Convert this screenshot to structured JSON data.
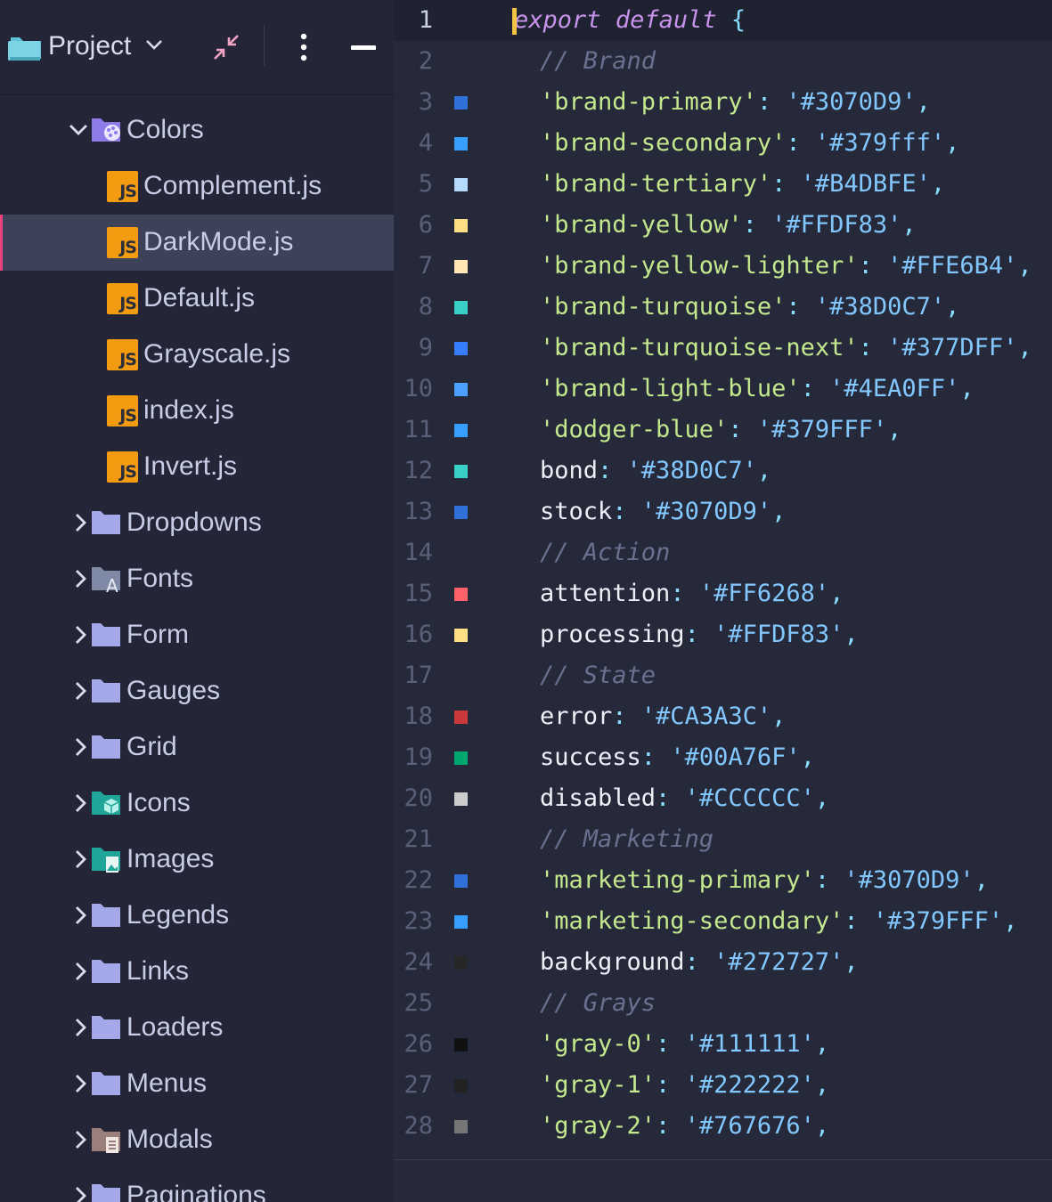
{
  "sidebar": {
    "title": "Project",
    "tree": [
      {
        "label": "Colors",
        "type": "folder-open",
        "icon": "palette-folder-icon"
      },
      {
        "label": "Complement.js",
        "type": "js"
      },
      {
        "label": "DarkMode.js",
        "type": "js",
        "selected": true
      },
      {
        "label": "Default.js",
        "type": "js"
      },
      {
        "label": "Grayscale.js",
        "type": "js"
      },
      {
        "label": "index.js",
        "type": "js"
      },
      {
        "label": "Invert.js",
        "type": "js"
      },
      {
        "label": "Dropdowns",
        "type": "folder"
      },
      {
        "label": "Fonts",
        "type": "folder-fonts"
      },
      {
        "label": "Form",
        "type": "folder"
      },
      {
        "label": "Gauges",
        "type": "folder"
      },
      {
        "label": "Grid",
        "type": "folder"
      },
      {
        "label": "Icons",
        "type": "folder-icons"
      },
      {
        "label": "Images",
        "type": "folder-images"
      },
      {
        "label": "Legends",
        "type": "folder"
      },
      {
        "label": "Links",
        "type": "folder"
      },
      {
        "label": "Loaders",
        "type": "folder"
      },
      {
        "label": "Menus",
        "type": "folder"
      },
      {
        "label": "Modals",
        "type": "folder-modals"
      },
      {
        "label": "Paginations",
        "type": "folder"
      }
    ],
    "js_badge": "JS"
  },
  "editor": {
    "lines": [
      {
        "n": "1",
        "kind": "open",
        "t1": "export",
        "t2": "default",
        "t3": "{"
      },
      {
        "n": "2",
        "kind": "comment",
        "text": "// Brand"
      },
      {
        "n": "3",
        "kind": "qkey",
        "key": "'brand-primary'",
        "val": "'#3070D9'",
        "swatch": "#3070D9"
      },
      {
        "n": "4",
        "kind": "qkey",
        "key": "'brand-secondary'",
        "val": "'#379fff'",
        "swatch": "#379fff"
      },
      {
        "n": "5",
        "kind": "qkey",
        "key": "'brand-tertiary'",
        "val": "'#B4DBFE'",
        "swatch": "#B4DBFE"
      },
      {
        "n": "6",
        "kind": "qkey",
        "key": "'brand-yellow'",
        "val": "'#FFDF83'",
        "swatch": "#FFDF83"
      },
      {
        "n": "7",
        "kind": "qkey",
        "key": "'brand-yellow-lighter'",
        "val": "'#FFE6B4'",
        "swatch": "#FFE6B4"
      },
      {
        "n": "8",
        "kind": "qkey",
        "key": "'brand-turquoise'",
        "val": "'#38D0C7'",
        "swatch": "#38D0C7"
      },
      {
        "n": "9",
        "kind": "qkey",
        "key": "'brand-turquoise-next'",
        "val": "'#377DFF'",
        "swatch": "#377DFF"
      },
      {
        "n": "10",
        "kind": "qkey",
        "key": "'brand-light-blue'",
        "val": "'#4EA0FF'",
        "swatch": "#4EA0FF"
      },
      {
        "n": "11",
        "kind": "qkey",
        "key": "'dodger-blue'",
        "val": "'#379FFF'",
        "swatch": "#379FFF"
      },
      {
        "n": "12",
        "kind": "key",
        "key": "bond",
        "val": "'#38D0C7'",
        "swatch": "#38D0C7"
      },
      {
        "n": "13",
        "kind": "key",
        "key": "stock",
        "val": "'#3070D9'",
        "swatch": "#3070D9"
      },
      {
        "n": "14",
        "kind": "comment",
        "text": "// Action"
      },
      {
        "n": "15",
        "kind": "key",
        "key": "attention",
        "val": "'#FF6268'",
        "swatch": "#FF6268"
      },
      {
        "n": "16",
        "kind": "key",
        "key": "processing",
        "val": "'#FFDF83'",
        "swatch": "#FFDF83"
      },
      {
        "n": "17",
        "kind": "comment",
        "text": "// State"
      },
      {
        "n": "18",
        "kind": "key",
        "key": "error",
        "val": "'#CA3A3C'",
        "swatch": "#CA3A3C"
      },
      {
        "n": "19",
        "kind": "key",
        "key": "success",
        "val": "'#00A76F'",
        "swatch": "#00A76F"
      },
      {
        "n": "20",
        "kind": "key",
        "key": "disabled",
        "val": "'#CCCCCC'",
        "swatch": "#CCCCCC"
      },
      {
        "n": "21",
        "kind": "comment",
        "text": "// Marketing"
      },
      {
        "n": "22",
        "kind": "qkey",
        "key": "'marketing-primary'",
        "val": "'#3070D9'",
        "swatch": "#3070D9"
      },
      {
        "n": "23",
        "kind": "qkey",
        "key": "'marketing-secondary'",
        "val": "'#379FFF'",
        "swatch": "#379FFF"
      },
      {
        "n": "24",
        "kind": "key",
        "key": "background",
        "val": "'#272727'",
        "swatch": "#272727"
      },
      {
        "n": "25",
        "kind": "comment",
        "text": "// Grays"
      },
      {
        "n": "26",
        "kind": "qkey",
        "key": "'gray-0'",
        "val": "'#111111'",
        "swatch": "#111111"
      },
      {
        "n": "27",
        "kind": "qkey",
        "key": "'gray-1'",
        "val": "'#222222'",
        "swatch": "#222222"
      },
      {
        "n": "28",
        "kind": "qkey",
        "key": "'gray-2'",
        "val": "'#767676'",
        "swatch": "#767676"
      }
    ]
  },
  "colors": {
    "accent_selected": "#e8417b",
    "js_badge": "#f39c12",
    "folder": "#a3a8e8",
    "cursor": "#f6c445"
  }
}
